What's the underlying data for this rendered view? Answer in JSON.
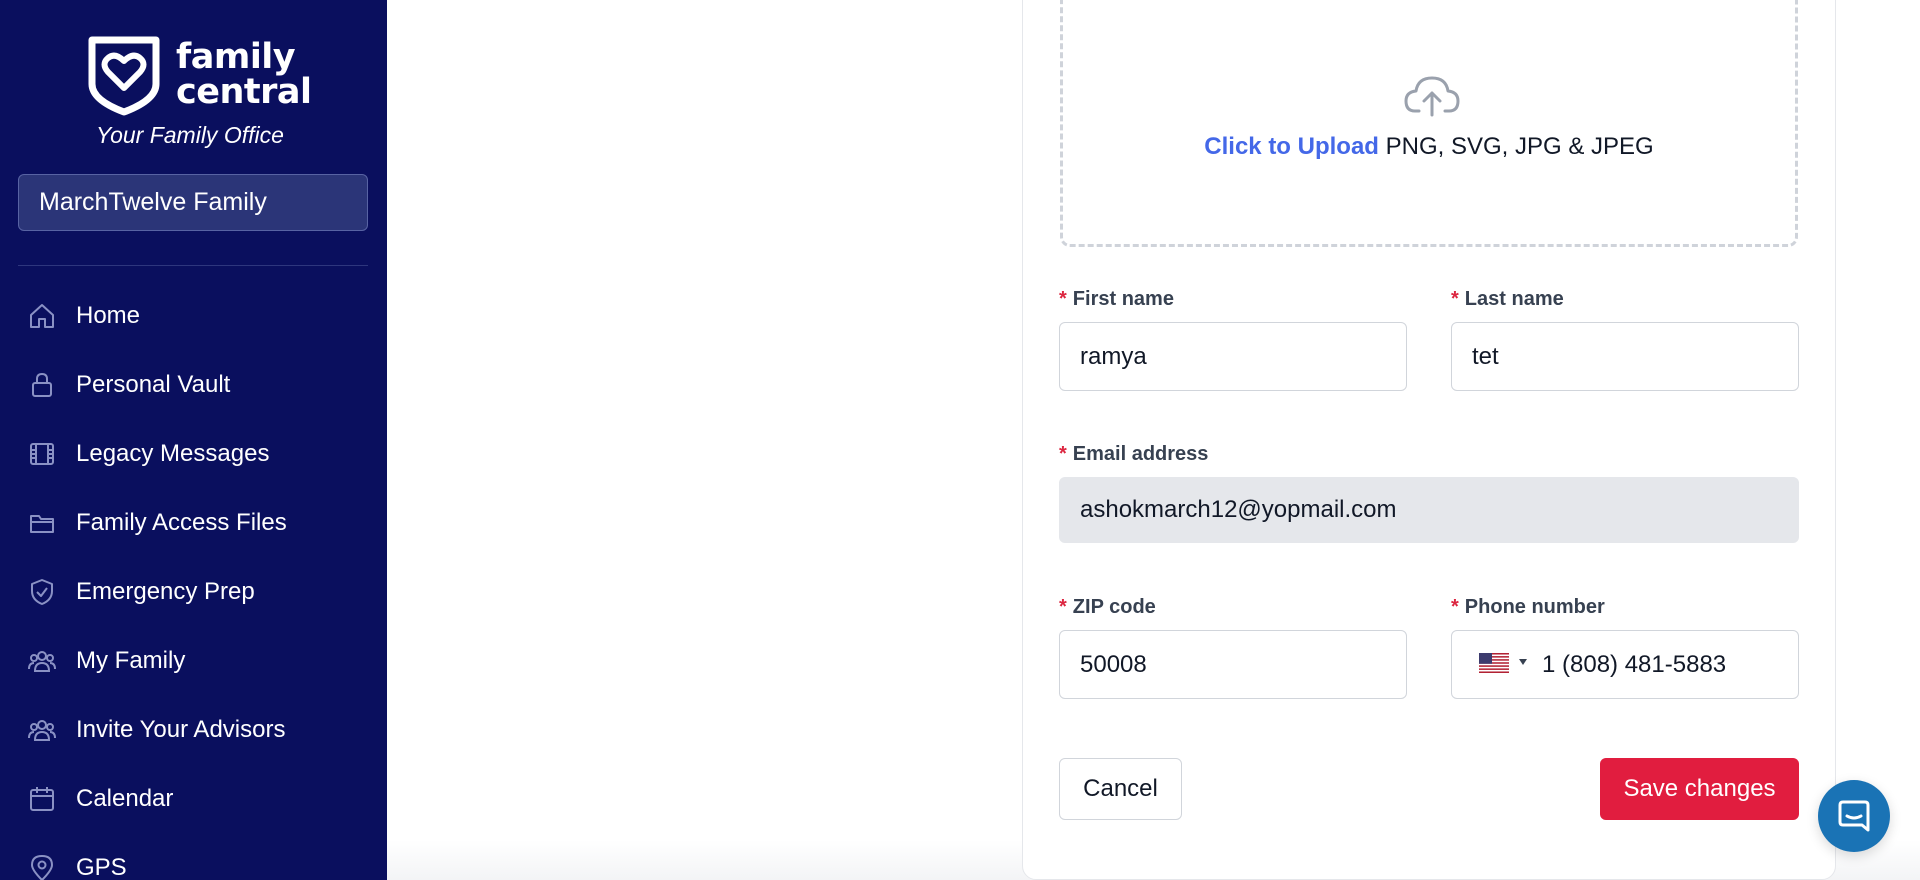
{
  "brand": {
    "name_line1": "family",
    "name_line2": "central",
    "tagline": "Your Family Office"
  },
  "sidebar": {
    "family_selector": "MarchTwelve Family",
    "items": [
      {
        "label": "Home",
        "icon": "home-icon"
      },
      {
        "label": "Personal Vault",
        "icon": "lock-icon"
      },
      {
        "label": "Legacy Messages",
        "icon": "film-icon"
      },
      {
        "label": "Family Access Files",
        "icon": "folder-icon"
      },
      {
        "label": "Emergency Prep",
        "icon": "shield-icon"
      },
      {
        "label": "My Family",
        "icon": "users-icon"
      },
      {
        "label": "Invite Your Advisors",
        "icon": "users-icon"
      },
      {
        "label": "Calendar",
        "icon": "calendar-icon"
      },
      {
        "label": "GPS",
        "icon": "location-pin-icon"
      }
    ]
  },
  "upload": {
    "link_text": "Click to Upload",
    "formats_text": "PNG, SVG, JPG & JPEG"
  },
  "form": {
    "required_marker": "*",
    "first_name": {
      "label": "First name",
      "value": "ramya"
    },
    "last_name": {
      "label": "Last name",
      "value": "tet"
    },
    "email": {
      "label": "Email address",
      "value": "ashokmarch12@yopmail.com"
    },
    "zip": {
      "label": "ZIP code",
      "value": "50008"
    },
    "phone": {
      "label": "Phone number",
      "value": "1 (808) 481-5883",
      "country": "US"
    }
  },
  "actions": {
    "cancel_label": "Cancel",
    "save_label": "Save changes"
  },
  "colors": {
    "sidebar_bg": "#0a0f5e",
    "accent_link": "#4468e8",
    "save_button": "#e11d3f",
    "required": "#dc2640",
    "chat_button": "#1a73b5"
  }
}
